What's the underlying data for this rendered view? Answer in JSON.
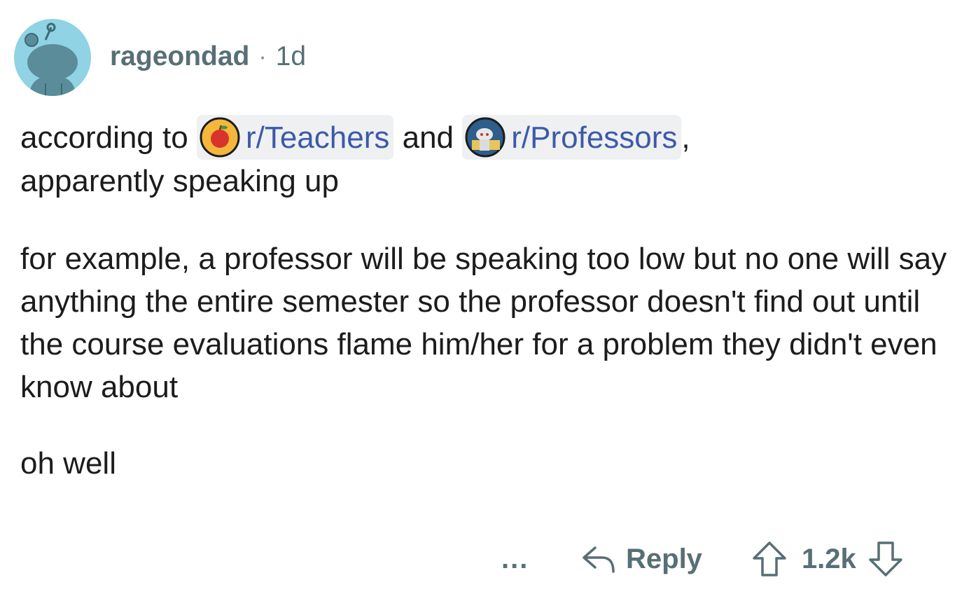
{
  "comment": {
    "username": "rageondad",
    "separator": "·",
    "age": "1d",
    "line1_before": "according to",
    "subreddit1": "r/Teachers",
    "line1_mid": "and",
    "subreddit2": "r/Professors",
    "line1_after": ",",
    "line2": "apparently speaking up",
    "paragraph2": "for example, a professor will be speaking too low but no one will say anything the entire semester so the professor doesn't find out until the course evaluations flame him/her for a problem they didn't even know about",
    "paragraph3": "oh well"
  },
  "actions": {
    "more_label": "...",
    "reply_label": "Reply",
    "vote_count": "1.2k"
  },
  "icons": {
    "avatar": "reddit-snoo-avatar",
    "subreddit1_icon": "apple-icon",
    "subreddit2_icon": "snoo-professor-icon",
    "reply_icon": "reply-arrow-icon",
    "upvote_icon": "upvote-arrow-icon",
    "downvote_icon": "downvote-arrow-icon"
  },
  "colors": {
    "link": "#3c5aa8",
    "meta": "#576f76",
    "chip_bg": "#eef0f2",
    "avatar_bg": "#8fd3e4"
  }
}
